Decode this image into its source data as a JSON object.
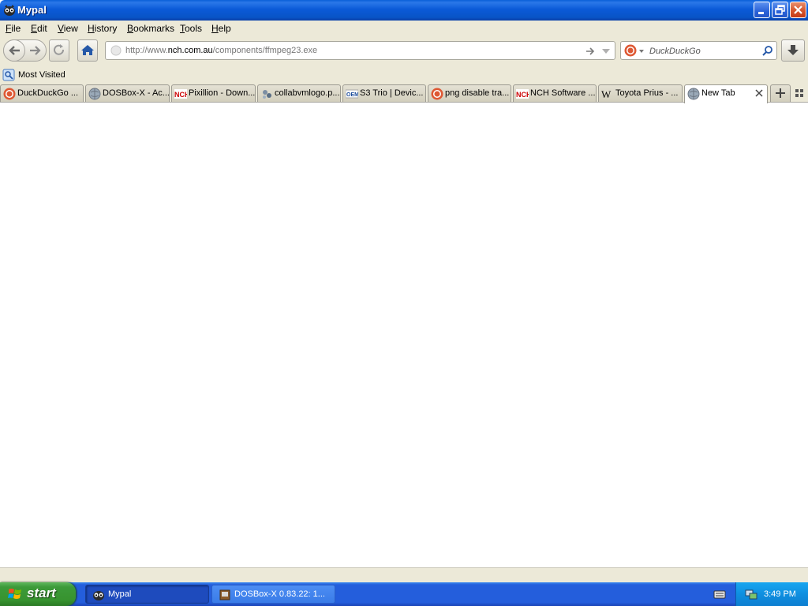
{
  "window": {
    "title": "Mypal"
  },
  "menu": {
    "items": [
      {
        "label": "File",
        "access": "F",
        "rest": "ile"
      },
      {
        "label": "Edit",
        "access": "E",
        "rest": "dit"
      },
      {
        "label": "View",
        "access": "V",
        "rest": "iew"
      },
      {
        "label": "History",
        "access": "H",
        "rest": "istory"
      },
      {
        "label": "Bookmarks",
        "access": "B",
        "rest": "ookmarks"
      },
      {
        "label": "Tools",
        "access": "T",
        "rest": "ools"
      },
      {
        "label": "Help",
        "access": "H",
        "rest": "elp"
      }
    ]
  },
  "navbar": {
    "url_prefix": "http://www.",
    "url_domain": "nch.com.au",
    "url_path": "/components/ffmpeg23.exe",
    "search_placeholder": "DuckDuckGo"
  },
  "bookmarks": {
    "items": [
      {
        "label": "Most Visited",
        "icon": "most-visited-icon"
      }
    ]
  },
  "tabs": [
    {
      "label": "DuckDuckGo ...",
      "icon": "duckduckgo-icon",
      "active": false
    },
    {
      "label": "DOSBox-X - Ac...",
      "icon": "globe-icon",
      "active": false
    },
    {
      "label": "Pixillion - Down...",
      "icon": "nch-icon",
      "active": false
    },
    {
      "label": "collabvmlogo.p...",
      "icon": "image-file-icon",
      "active": false
    },
    {
      "label": "S3 Trio | Devic...",
      "icon": "oem-icon",
      "active": false
    },
    {
      "label": "png disable tra...",
      "icon": "duckduckgo-icon",
      "active": false
    },
    {
      "label": "NCH Software ...",
      "icon": "nch-icon",
      "active": false
    },
    {
      "label": "Toyota Prius - ...",
      "icon": "wikipedia-icon",
      "active": false
    },
    {
      "label": "New Tab",
      "icon": "globe-icon",
      "active": true
    }
  ],
  "taskbar": {
    "start_label": "start",
    "items": [
      {
        "label": "Mypal",
        "active": true
      },
      {
        "label": "DOSBox-X 0.83.22: 1...",
        "active": false
      }
    ],
    "clock": "3:49 PM"
  },
  "colors": {
    "titlebar_blue": "#0b5ad8",
    "taskbar_blue": "#245edc",
    "start_green": "#3c9a39",
    "chrome_beige": "#ece9d8"
  }
}
